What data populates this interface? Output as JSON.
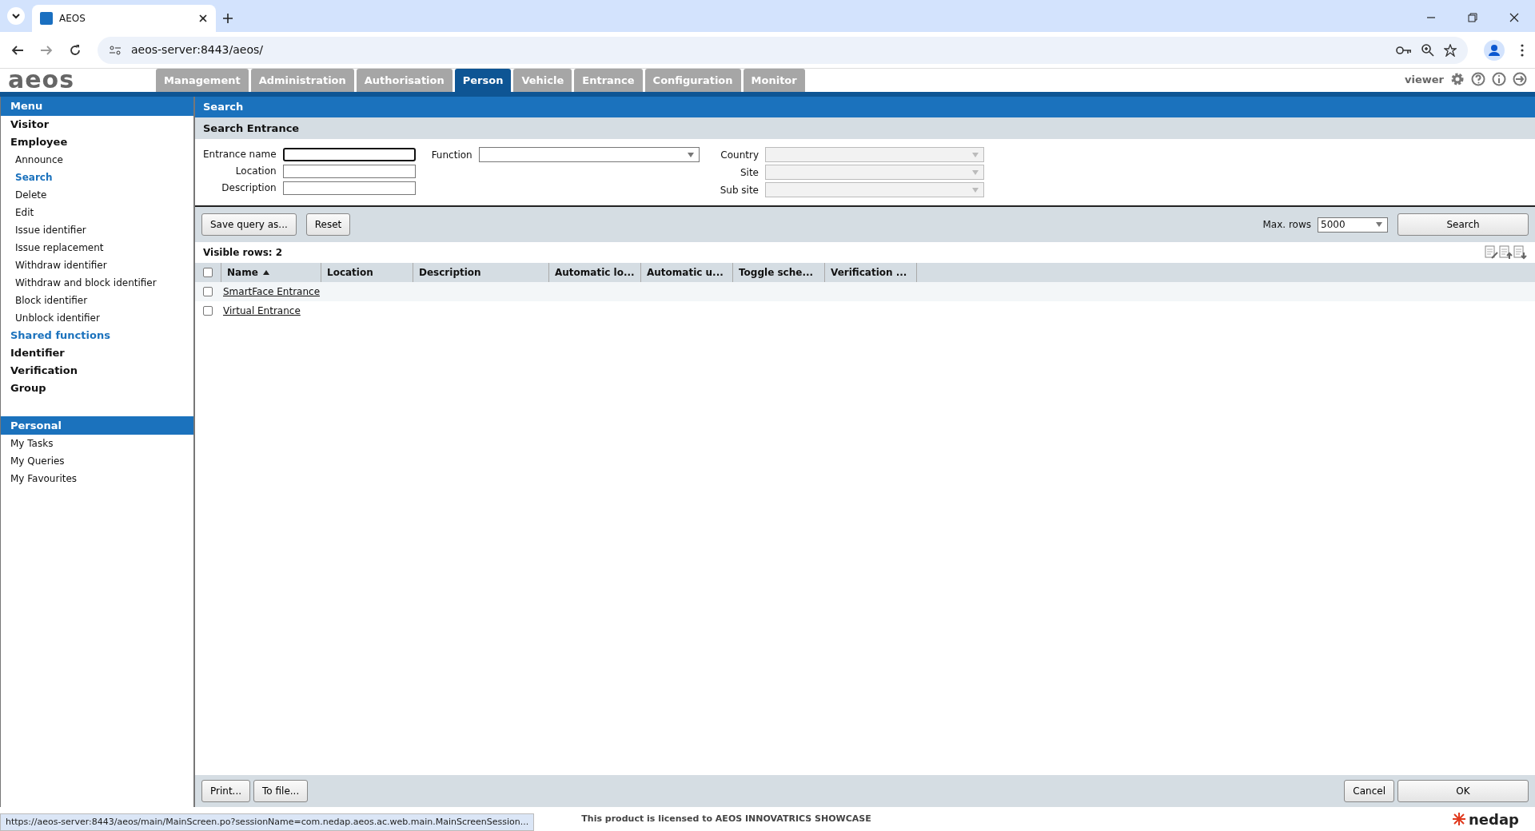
{
  "browser": {
    "tab_title": "AEOS",
    "url": "aeos-server:8443/aeos/"
  },
  "app": {
    "logo": "aeos",
    "user": "viewer"
  },
  "nav_tabs": [
    {
      "label": "Management",
      "selected": false
    },
    {
      "label": "Administration",
      "selected": false
    },
    {
      "label": "Authorisation",
      "selected": false
    },
    {
      "label": "Person",
      "selected": true
    },
    {
      "label": "Vehicle",
      "selected": false
    },
    {
      "label": "Entrance",
      "selected": false
    },
    {
      "label": "Configuration",
      "selected": false
    },
    {
      "label": "Monitor",
      "selected": false
    }
  ],
  "menu": {
    "title": "Menu",
    "items": [
      {
        "label": "Visitor",
        "kind": "group"
      },
      {
        "label": "Employee",
        "kind": "group",
        "children": [
          {
            "label": "Announce",
            "selected": false
          },
          {
            "label": "Search",
            "selected": true
          },
          {
            "label": "Delete",
            "selected": false
          },
          {
            "label": "Edit",
            "selected": false
          },
          {
            "label": "Issue identifier",
            "selected": false
          },
          {
            "label": "Issue replacement",
            "selected": false
          },
          {
            "label": "Withdraw identifier",
            "selected": false
          },
          {
            "label": "Withdraw and block identifier",
            "selected": false
          },
          {
            "label": "Block identifier",
            "selected": false
          },
          {
            "label": "Unblock identifier",
            "selected": false
          }
        ]
      },
      {
        "label": "Shared functions",
        "kind": "link"
      },
      {
        "label": "Identifier",
        "kind": "group"
      },
      {
        "label": "Verification",
        "kind": "group"
      },
      {
        "label": "Group",
        "kind": "group"
      }
    ]
  },
  "personal": {
    "title": "Personal",
    "items": [
      "My Tasks",
      "My Queries",
      "My Favourites"
    ]
  },
  "page": {
    "title": "Search",
    "subtitle": "Search Entrance"
  },
  "form": {
    "left": [
      {
        "label": "Entrance name",
        "focused": true
      },
      {
        "label": "Location",
        "focused": false
      },
      {
        "label": "Description",
        "focused": false
      }
    ],
    "middle": [
      {
        "label": "Function",
        "disabled": false
      }
    ],
    "right": [
      {
        "label": "Country",
        "disabled": true
      },
      {
        "label": "Site",
        "disabled": true
      },
      {
        "label": "Sub site",
        "disabled": true
      }
    ]
  },
  "toolbar": {
    "buttons": [
      "Save query as...",
      "Reset"
    ],
    "max_rows_label": "Max. rows",
    "max_rows": "5000",
    "search_button": "Search"
  },
  "visible_rows": "Visible rows: 2",
  "table": {
    "select_all_checked": false,
    "columns": [
      {
        "label": "Name",
        "sorted": true
      },
      {
        "label": "Location",
        "sorted": false
      },
      {
        "label": "Description",
        "sorted": false
      },
      {
        "label": "Automatic lo...",
        "sorted": false
      },
      {
        "label": "Automatic u...",
        "sorted": false
      },
      {
        "label": "Toggle sche...",
        "sorted": false
      },
      {
        "label": "Verification ...",
        "sorted": false
      }
    ],
    "rows": [
      {
        "name": "SmartFace Entrance",
        "checked": false
      },
      {
        "name": "Virtual Entrance",
        "checked": false
      }
    ]
  },
  "bottom": {
    "left": [
      "Print...",
      "To file..."
    ],
    "right": [
      "Cancel",
      "OK"
    ]
  },
  "status_url": "https://aeos-server:8443/aeos/main/MainScreen.po?sessionName=com.nedap.aeos.ac.web.main.MainScreenSession...",
  "license": "This product is licensed to AEOS INNOVATRICS SHOWCASE",
  "footer_logo": "nedap"
}
